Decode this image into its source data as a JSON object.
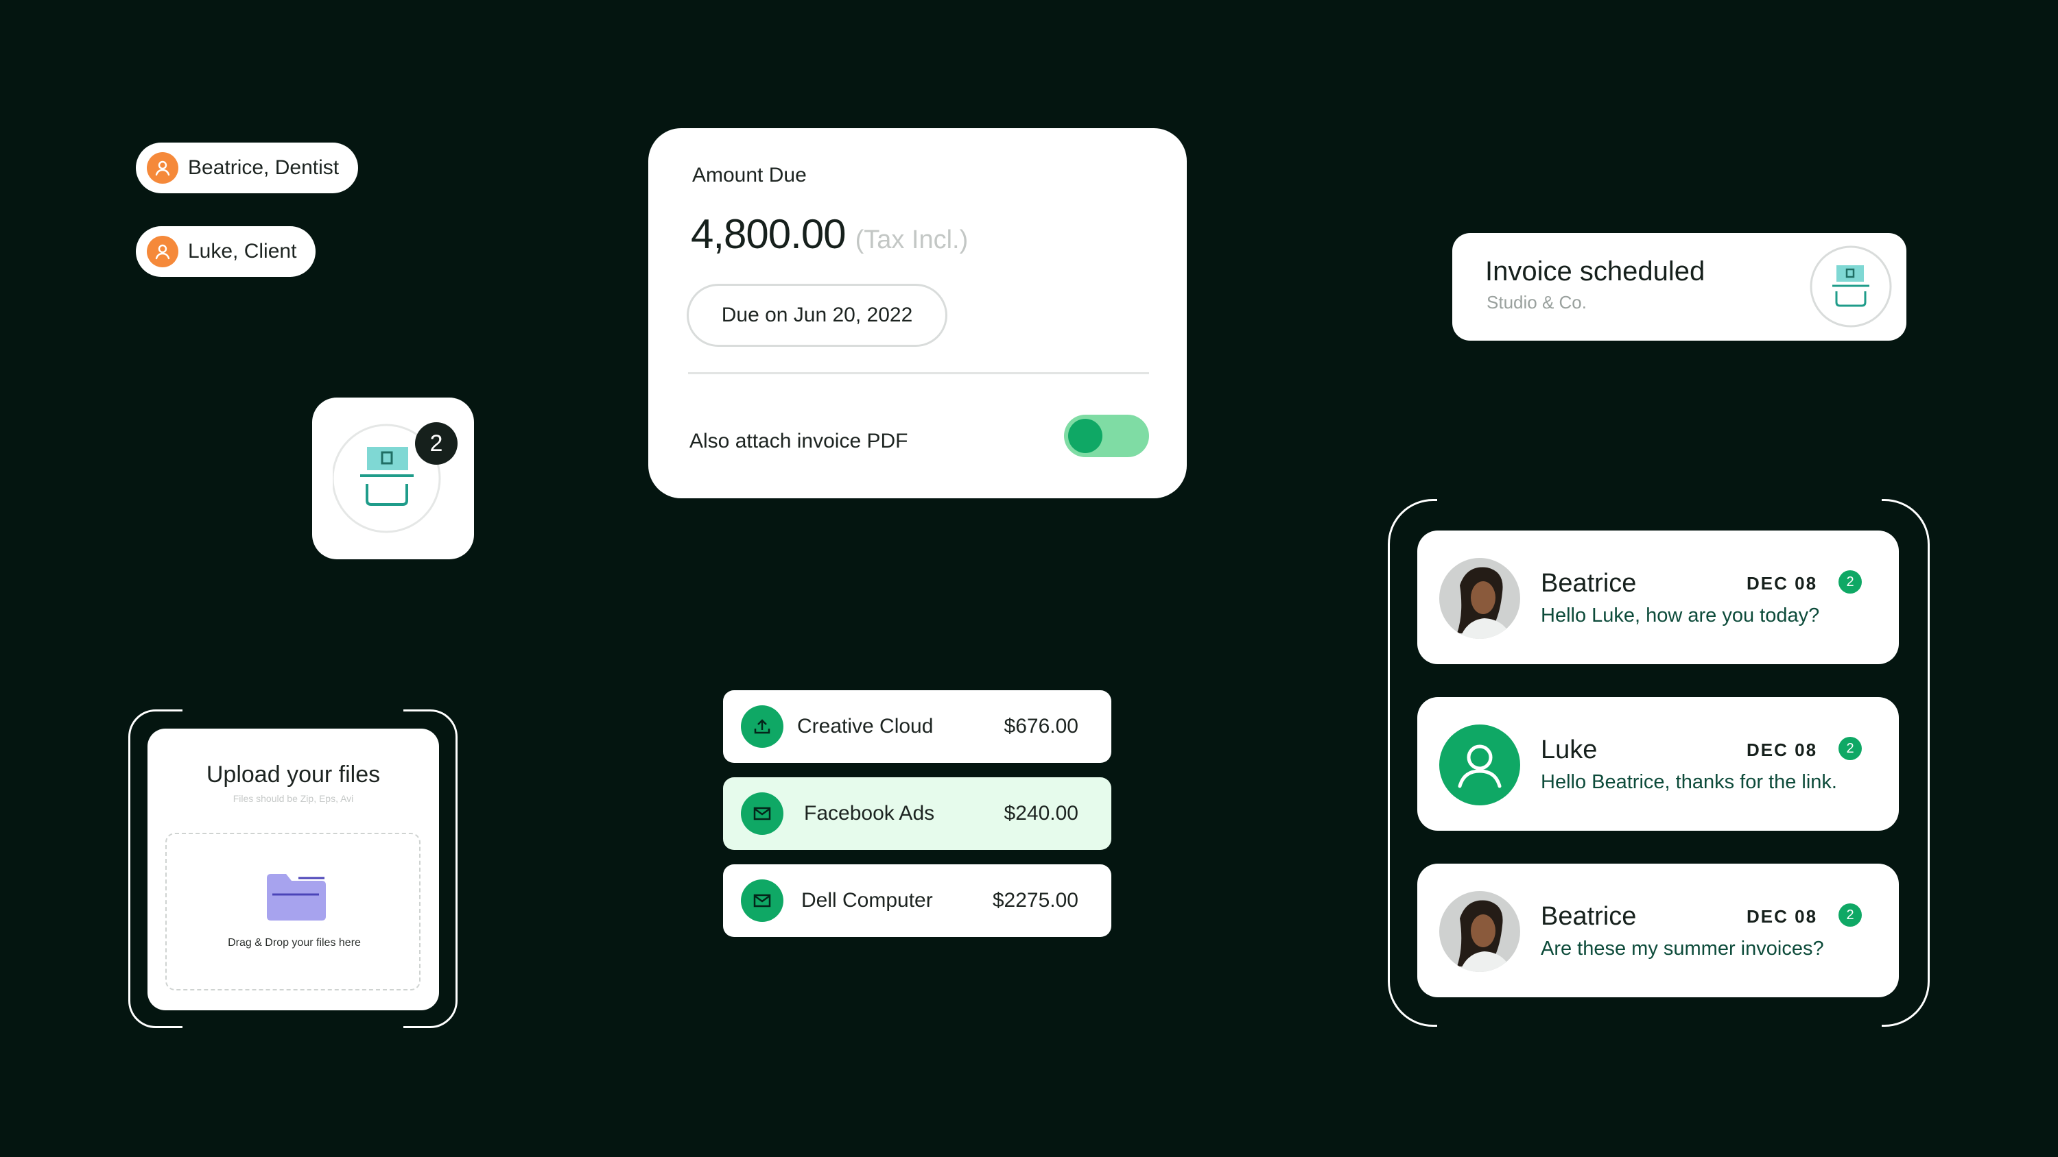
{
  "chips": [
    {
      "label": "Beatrice, Dentist",
      "icon": "user-icon"
    },
    {
      "label": "Luke, Client",
      "icon": "user-icon"
    }
  ],
  "inbox_badge": {
    "count": "2",
    "icon": "inbox-tray-icon"
  },
  "amount_card": {
    "label": "Amount Due",
    "amount": "4,800.00",
    "tax_note": "(Tax Incl.)",
    "due_button": "Due on Jun 20, 2022",
    "attach_label": "Also attach invoice PDF",
    "attach_enabled": true
  },
  "scheduled": {
    "title": "Invoice scheduled",
    "subtitle": "Studio & Co.",
    "icon": "inbox-tray-icon"
  },
  "upload": {
    "title": "Upload your files",
    "subtitle": "Files should be Zip, Eps, Avi",
    "drop_text": "Drag & Drop your files here",
    "icon": "folder-icon"
  },
  "transactions": [
    {
      "name": "Creative Cloud",
      "amount": "$676.00",
      "icon": "upload-icon",
      "highlighted": false
    },
    {
      "name": "Facebook Ads",
      "amount": "$240.00",
      "icon": "mail-icon",
      "highlighted": true
    },
    {
      "name": "Dell Computer",
      "amount": "$2275.00",
      "icon": "mail-icon",
      "highlighted": false
    }
  ],
  "messages": [
    {
      "name": "Beatrice",
      "date": "DEC 08",
      "count": "2",
      "text": "Hello Luke, how are you today?",
      "avatar": "photo"
    },
    {
      "name": "Luke",
      "date": "DEC 08",
      "count": "2",
      "text": "Hello Beatrice, thanks for the link.",
      "avatar": "user-icon"
    },
    {
      "name": "Beatrice",
      "date": "DEC 08",
      "count": "2",
      "text": "Are these my summer invoices?",
      "avatar": "photo"
    }
  ],
  "colors": {
    "background": "#041510",
    "accent_green": "#0fa865",
    "toggle_track": "#7fdca4",
    "chip_avatar": "#f5893a",
    "highlight_row": "#e6fbec",
    "icon_teal": "#1f9c8a",
    "icon_screen": "#7fd8d4",
    "folder_purple": "#a7a3ee"
  }
}
